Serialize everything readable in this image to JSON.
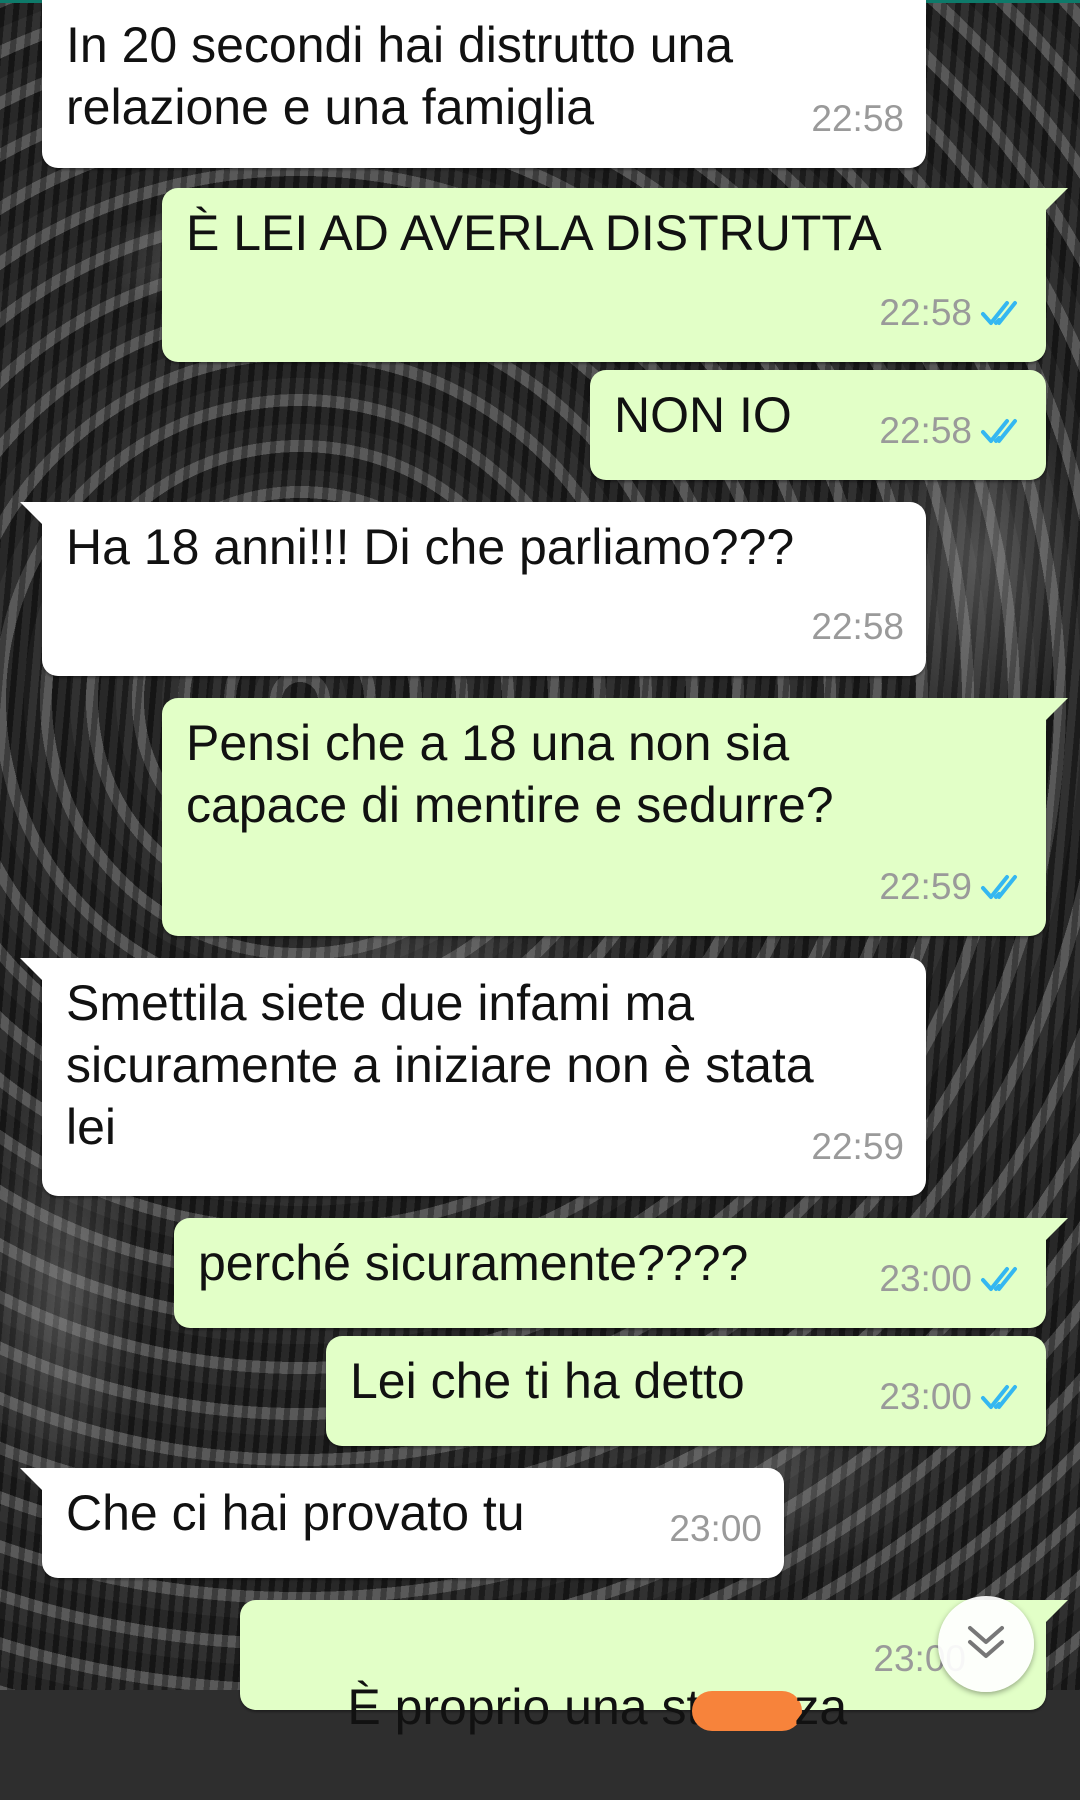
{
  "colors": {
    "incoming_bubble": "#ffffff",
    "outgoing_bubble": "#e2ffc7",
    "read_ticks": "#34b7f1",
    "timestamp": "#9a9a9a",
    "redaction": "#f7833b"
  },
  "messages": [
    {
      "direction": "incoming",
      "text": "In 20 secondi hai distrutto una\nrelazione e una famiglia",
      "time": "22:58"
    },
    {
      "direction": "outgoing",
      "text": "È LEI AD AVERLA DISTRUTTA",
      "time": "22:58",
      "status": "read"
    },
    {
      "direction": "outgoing",
      "text": "NON IO",
      "time": "22:58",
      "status": "read"
    },
    {
      "direction": "incoming",
      "text": "Ha 18 anni!!! Di che parliamo???",
      "time": "22:58"
    },
    {
      "direction": "outgoing",
      "text": "Pensi che a 18 una non sia\ncapace di mentire e sedurre?",
      "time": "22:59",
      "status": "read"
    },
    {
      "direction": "incoming",
      "text": "Smettila siete due infami ma\nsicuramente a iniziare non è stata\nlei",
      "time": "22:59"
    },
    {
      "direction": "outgoing",
      "text": "perché sicuramente????",
      "time": "23:00",
      "status": "read"
    },
    {
      "direction": "outgoing",
      "text": "Lei che ti ha detto",
      "time": "23:00",
      "status": "read"
    },
    {
      "direction": "incoming",
      "text": "Che ci hai provato tu",
      "time": "23:00"
    },
    {
      "direction": "outgoing",
      "text_before": "È proprio una st",
      "text_after": "za",
      "time": "23:00",
      "status": "read"
    }
  ],
  "icons": {
    "read_receipt": "double-check-icon",
    "scroll_down": "chevron-double-down-icon"
  }
}
